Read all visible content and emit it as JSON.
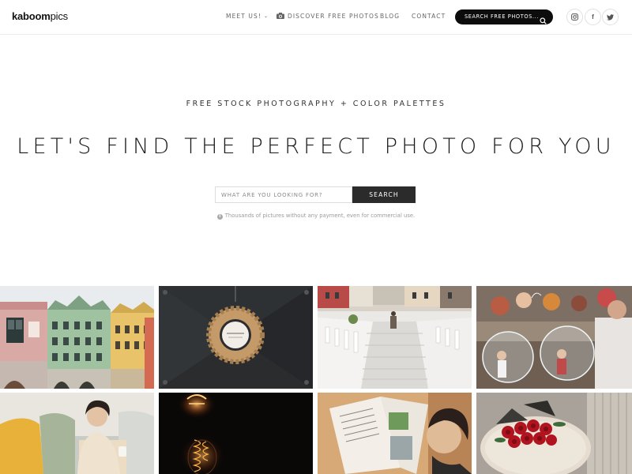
{
  "header": {
    "logo": {
      "bold": "kaboom",
      "light": "pics"
    },
    "nav": {
      "meet_us": "MEET US!",
      "discover": "DISCOVER FREE PHOTOS",
      "blog": "BLOG",
      "contact": "CONTACT"
    },
    "search_button_label": "SEARCH FREE PHOTOS...",
    "social_icons": [
      "instagram-icon",
      "facebook-icon",
      "twitter-icon"
    ]
  },
  "hero": {
    "tagline": "FREE STOCK PHOTOGRAPHY + COLOR PALETTES",
    "headline": "LET'S FIND THE PERFECT PHOTO FOR YOU",
    "search": {
      "placeholder": "WHAT ARE YOU LOOKING FOR?",
      "button": "SEARCH"
    },
    "hint": "Thousands of pictures without any payment, even for commercial use."
  },
  "gallery": {
    "photos": [
      {
        "subject": "colorful old town houses"
      },
      {
        "subject": "wine cork wreath on dark door"
      },
      {
        "subject": "white stone staircase in old town"
      },
      {
        "subject": "children with soap bubbles"
      },
      {
        "subject": "woman on sofa with mug"
      },
      {
        "subject": "edison bulb in dark"
      },
      {
        "subject": "woman reading magazine"
      },
      {
        "subject": "red roses bouquet on table"
      }
    ],
    "colors": {
      "text_dark": "#1a1a1a",
      "button_dark": "#2b2b2b",
      "pill_black": "#0c0c0c"
    }
  }
}
